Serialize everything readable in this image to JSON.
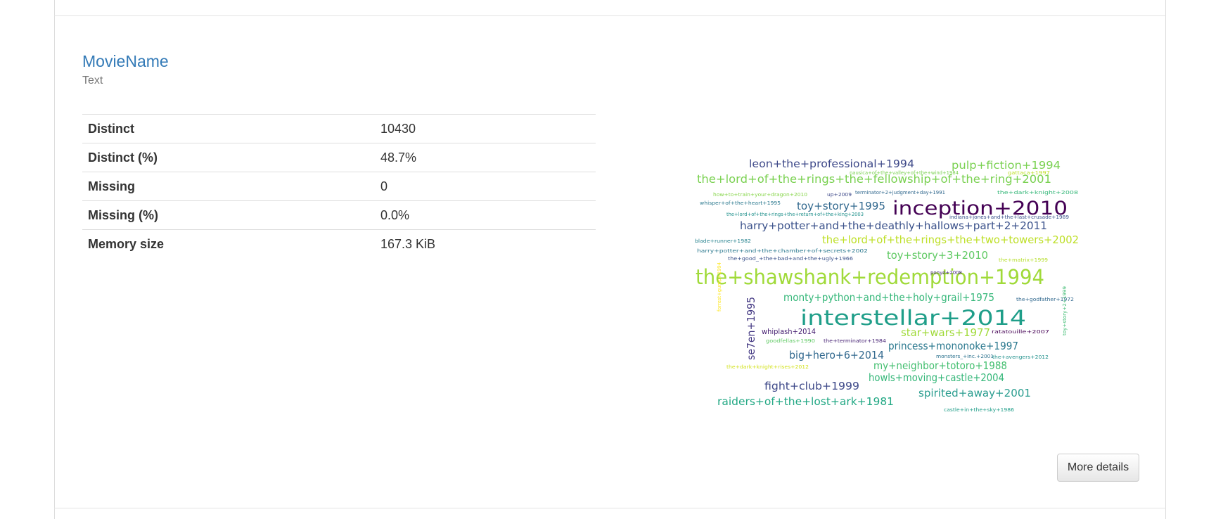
{
  "variable": {
    "name": "MovieName",
    "type": "Text"
  },
  "stats": [
    {
      "label": "Distinct",
      "value": "10430"
    },
    {
      "label": "Distinct (%)",
      "value": "48.7%"
    },
    {
      "label": "Missing",
      "value": "0"
    },
    {
      "label": "Missing (%)",
      "value": "0.0%"
    },
    {
      "label": "Memory size",
      "value": "167.3 KiB"
    }
  ],
  "wordcloud": {
    "words": [
      {
        "text": "the+shawshank+redemption+1994",
        "color": "#a0da39"
      },
      {
        "text": "interstellar+2014",
        "color": "#1f9e89"
      },
      {
        "text": "inception+2010",
        "color": "#440154"
      },
      {
        "text": "the+lord+of+the+rings+the+fellowship+of+the+ring+2001",
        "color": "#7ad151"
      },
      {
        "text": "harry+potter+and+the+deathly+hallows+part+2+2011",
        "color": "#3b528b"
      },
      {
        "text": "the+lord+of+the+rings+the+two+towers+2002",
        "color": "#bddf26"
      },
      {
        "text": "leon+the+professional+1994",
        "color": "#3e4989"
      },
      {
        "text": "pulp+fiction+1994",
        "color": "#7ad151"
      },
      {
        "text": "toy+story+1995",
        "color": "#31688e"
      },
      {
        "text": "toy+story+3+2010",
        "color": "#5ec962"
      },
      {
        "text": "monty+python+and+the+holy+grail+1975",
        "color": "#35b779"
      },
      {
        "text": "star+wars+1977",
        "color": "#a0da39"
      },
      {
        "text": "princess+mononoke+1997",
        "color": "#2a788e"
      },
      {
        "text": "big+hero+6+2014",
        "color": "#31688e"
      },
      {
        "text": "my+neighbor+totoro+1988",
        "color": "#44bf70"
      },
      {
        "text": "howls+moving+castle+2004",
        "color": "#35b779"
      },
      {
        "text": "fight+club+1999",
        "color": "#3e4989"
      },
      {
        "text": "spirited+away+2001",
        "color": "#2a9d8f"
      },
      {
        "text": "raiders+of+the+lost+ark+1981",
        "color": "#22a884"
      },
      {
        "text": "se7en+1995",
        "color": "#443983"
      },
      {
        "text": "whiplash+2014",
        "color": "#482173"
      },
      {
        "text": "nausica+of+the+valley+of+the+wind+1984",
        "color": "#7ad151"
      },
      {
        "text": "gattaca+1997",
        "color": "#bddf26"
      },
      {
        "text": "how+to+train+your+dragon+2010",
        "color": "#86d549"
      },
      {
        "text": "up+2009",
        "color": "#3e4989"
      },
      {
        "text": "terminator+2+judgment+day+1991",
        "color": "#31688e"
      },
      {
        "text": "the+dark+knight+2008",
        "color": "#35b779"
      },
      {
        "text": "whisper+of+the+heart+1995",
        "color": "#2a788e"
      },
      {
        "text": "the+lord+of+the+rings+the+return+of+the+king+2003",
        "color": "#21918c"
      },
      {
        "text": "indiana+jones+and+the+last+crusade+1989",
        "color": "#3b528b"
      },
      {
        "text": "blade+runner+1982",
        "color": "#26828e"
      },
      {
        "text": "harry+potter+and+the+chamber+of+secrets+2002",
        "color": "#2a788e"
      },
      {
        "text": "the+good_+the+bad+and+the+ugly+1966",
        "color": "#3b528b"
      },
      {
        "text": "the+matrix+1999",
        "color": "#b5de2b"
      },
      {
        "text": "ponyo+2008",
        "color": "#472d7b"
      },
      {
        "text": "the+godfather+1972",
        "color": "#31688e"
      },
      {
        "text": "forrest+gump+1994",
        "color": "#fde725"
      },
      {
        "text": "ratatouille+2007",
        "color": "#440154"
      },
      {
        "text": "goodfellas+1990",
        "color": "#5ec962"
      },
      {
        "text": "the+terminator+1984",
        "color": "#482475"
      },
      {
        "text": "monsters_+inc.+2001",
        "color": "#2c728e"
      },
      {
        "text": "the+avengers+2012",
        "color": "#21918c"
      },
      {
        "text": "toy+story+2+1999",
        "color": "#3fbc73"
      },
      {
        "text": "the+dark+knight+rises+2012",
        "color": "#d2e21b"
      },
      {
        "text": "castle+in+the+sky+1986",
        "color": "#1f9e89"
      }
    ]
  },
  "actions": {
    "more_details": "More details"
  }
}
